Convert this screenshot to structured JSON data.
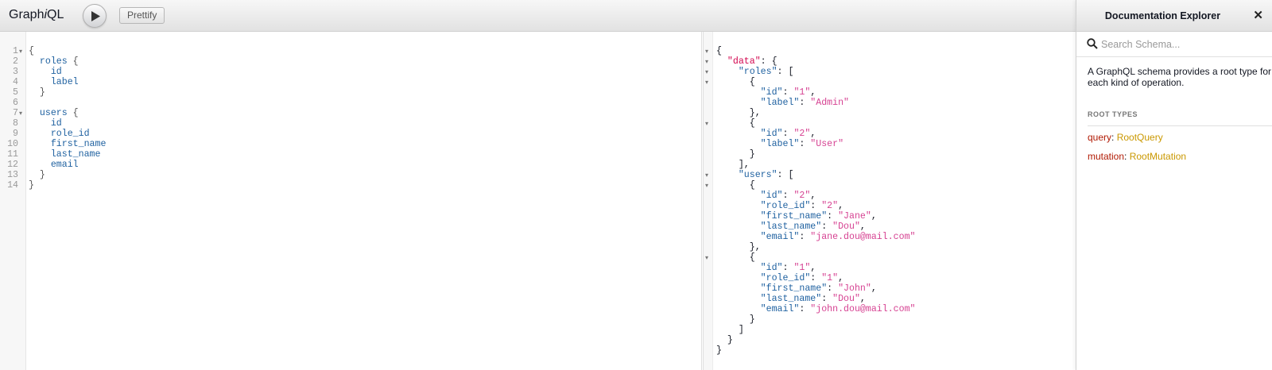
{
  "toolbar": {
    "title_prefix": "Graph",
    "title_italic": "i",
    "title_suffix": "QL",
    "execute_icon": "play-icon",
    "prettify_label": "Prettify"
  },
  "query_editor": {
    "line_numbers": [
      "1",
      "2",
      "3",
      "4",
      "5",
      "6",
      "7",
      "8",
      "9",
      "10",
      "11",
      "12",
      "13",
      "14"
    ],
    "lines": [
      {
        "indent": "",
        "text": "{",
        "kind": "punct"
      },
      {
        "indent": "  ",
        "text": "roles",
        "suffix": " {",
        "kind": "field"
      },
      {
        "indent": "    ",
        "text": "id",
        "kind": "field"
      },
      {
        "indent": "    ",
        "text": "label",
        "kind": "field"
      },
      {
        "indent": "  ",
        "text": "}",
        "kind": "punct"
      },
      {
        "indent": "",
        "text": "",
        "kind": "punct"
      },
      {
        "indent": "  ",
        "text": "users",
        "suffix": " {",
        "kind": "field"
      },
      {
        "indent": "    ",
        "text": "id",
        "kind": "field"
      },
      {
        "indent": "    ",
        "text": "role_id",
        "kind": "field"
      },
      {
        "indent": "    ",
        "text": "first_name",
        "kind": "field"
      },
      {
        "indent": "    ",
        "text": "last_name",
        "kind": "field"
      },
      {
        "indent": "    ",
        "text": "email",
        "kind": "field"
      },
      {
        "indent": "  ",
        "text": "}",
        "kind": "punct"
      },
      {
        "indent": "",
        "text": "}",
        "kind": "punct"
      }
    ]
  },
  "result_viewer": {
    "lines": [
      "{",
      "  \"data\": {",
      "    \"roles\": [",
      "      {",
      "        \"id\": \"1\",",
      "        \"label\": \"Admin\"",
      "      },",
      "      {",
      "        \"id\": \"2\",",
      "        \"label\": \"User\"",
      "      }",
      "    ],",
      "    \"users\": [",
      "      {",
      "        \"id\": \"2\",",
      "        \"role_id\": \"2\",",
      "        \"first_name\": \"Jane\",",
      "        \"last_name\": \"Dou\",",
      "        \"email\": \"jane.dou@mail.com\"",
      "      },",
      "      {",
      "        \"id\": \"1\",",
      "        \"role_id\": \"1\",",
      "        \"first_name\": \"John\",",
      "        \"last_name\": \"Dou\",",
      "        \"email\": \"john.dou@mail.com\"",
      "      }",
      "    ]",
      "  }",
      "}"
    ]
  },
  "docs": {
    "title": "Documentation Explorer",
    "close_icon": "close-icon",
    "search_placeholder": "Search Schema...",
    "search_icon": "search-icon",
    "description_line1": "A GraphQL schema provides a root type for",
    "description_line2": "each kind of operation.",
    "root_types_label": "ROOT TYPES",
    "root_types": [
      {
        "field": "query",
        "type": "RootQuery"
      },
      {
        "field": "mutation",
        "type": "RootMutation"
      }
    ]
  },
  "colors": {
    "field": "#1f61a0",
    "string": "#d64292",
    "top_key": "#d2054e",
    "root_field": "#b11a04",
    "root_type": "#ca9800"
  }
}
